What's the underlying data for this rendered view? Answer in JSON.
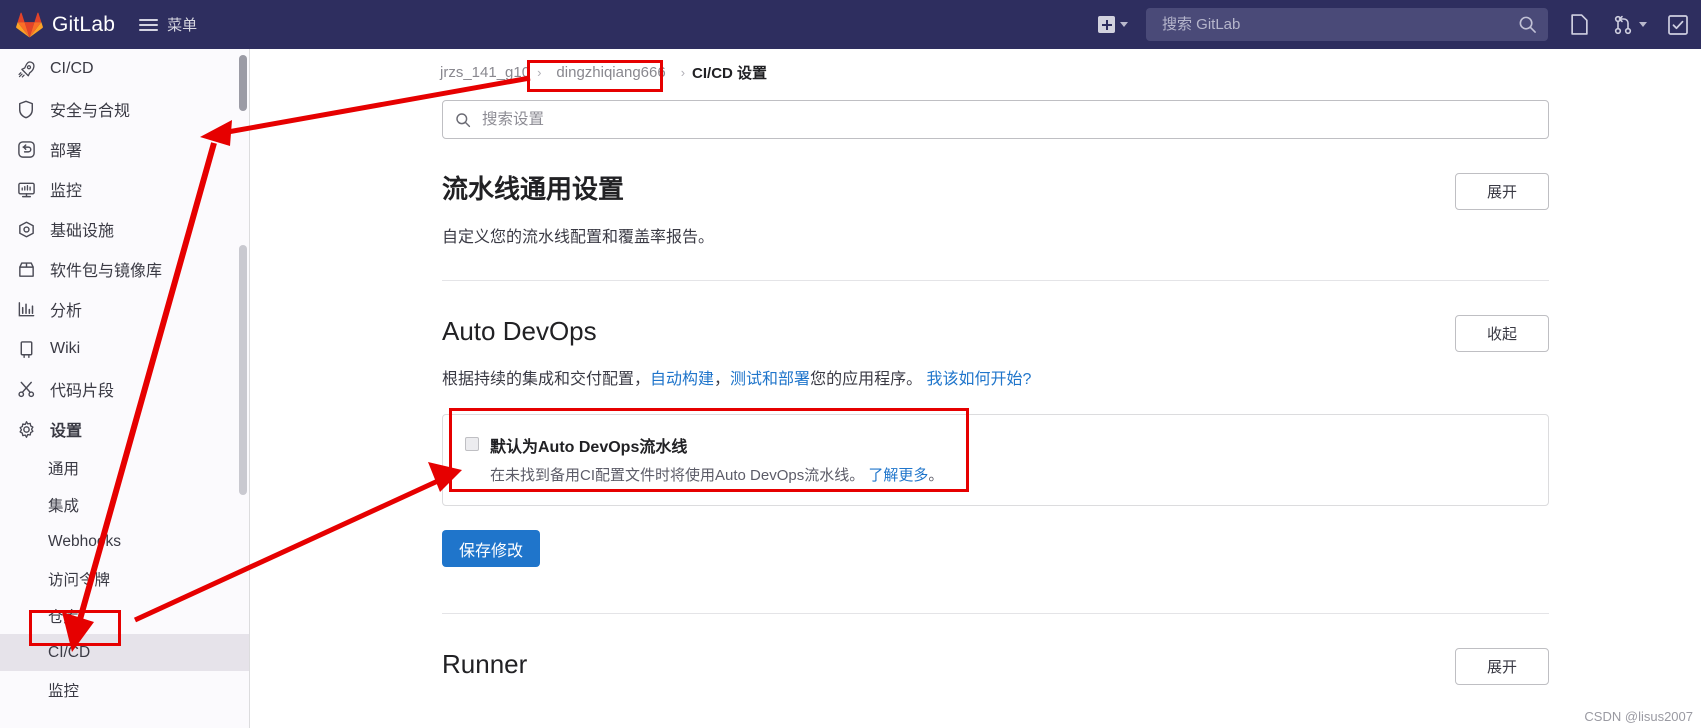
{
  "topbar": {
    "brand": "GitLab",
    "menu_label": "菜单",
    "logo_icon": "gitlab-tanuki-logo",
    "hamburger_icon": "hamburger-menu-icon",
    "plus_icon": "plus-square-icon",
    "plus_caret_icon": "chevron-down-icon",
    "search": {
      "placeholder": "搜索 GitLab",
      "value": "",
      "icon": "search-icon"
    },
    "icons": [
      {
        "name": "issues-icon",
        "glyph": "issues"
      },
      {
        "name": "merge-requests-icon",
        "glyph": "merge"
      },
      {
        "name": "merge-caret-icon",
        "glyph": "caret"
      },
      {
        "name": "todos-icon",
        "glyph": "todo"
      }
    ]
  },
  "sidebar": {
    "items": [
      {
        "label": "CI/CD",
        "icon": "rocket-icon",
        "type": "top"
      },
      {
        "label": "安全与合规",
        "icon": "shield-icon",
        "type": "top"
      },
      {
        "label": "部署",
        "icon": "deploy-icon",
        "type": "top"
      },
      {
        "label": "监控",
        "icon": "monitor-icon",
        "type": "top"
      },
      {
        "label": "基础设施",
        "icon": "infrastructure-icon",
        "type": "top"
      },
      {
        "label": "软件包与镜像库",
        "icon": "package-icon",
        "type": "top"
      },
      {
        "label": "分析",
        "icon": "analytics-icon",
        "type": "top"
      },
      {
        "label": "Wiki",
        "icon": "book-icon",
        "type": "top"
      },
      {
        "label": "代码片段",
        "icon": "snippet-icon",
        "type": "top"
      },
      {
        "label": "设置",
        "icon": "gear-icon",
        "type": "top",
        "bold": true
      }
    ],
    "sub_items": [
      {
        "label": "通用",
        "active": false
      },
      {
        "label": "集成",
        "active": false
      },
      {
        "label": "Webhooks",
        "active": false
      },
      {
        "label": "访问令牌",
        "active": false
      },
      {
        "label": "仓库",
        "active": false
      },
      {
        "label": "CI/CD",
        "active": true
      },
      {
        "label": "监控",
        "active": false
      }
    ]
  },
  "breadcrumb": {
    "group": "jrzs_141_g10",
    "sep": "›",
    "project": "dingzhiqiang666",
    "current": "CI/CD 设置"
  },
  "settings_search": {
    "placeholder": "搜索设置",
    "value": "",
    "icon": "search-icon"
  },
  "sections": [
    {
      "title": "流水线通用设置",
      "description": "自定义您的流水线配置和覆盖率报告。",
      "button": "展开"
    },
    {
      "title": "Auto DevOps",
      "button": "收起",
      "desc_parts": [
        {
          "text": "根据持续的集成和交付配置，",
          "link": false
        },
        {
          "text": "自动构建",
          "link": true
        },
        {
          "text": "，",
          "link": false
        },
        {
          "text": "测试和部署",
          "link": true
        },
        {
          "text": "您的应用程序。 ",
          "link": false
        },
        {
          "text": "我该如何开始?",
          "link": true
        }
      ],
      "checkbox": {
        "label": "默认为Auto DevOps流水线",
        "checked": false,
        "help_text": "在未找到备用CI配置文件时将使用Auto DevOps流水线。",
        "help_link": "了解更多",
        "help_tail": "。"
      },
      "save_label": "保存修改"
    },
    {
      "title": "Runner",
      "button": "展开"
    }
  ],
  "annotations": {
    "accent_color": "#e60000",
    "watermark": "CSDN @lisus2007"
  }
}
